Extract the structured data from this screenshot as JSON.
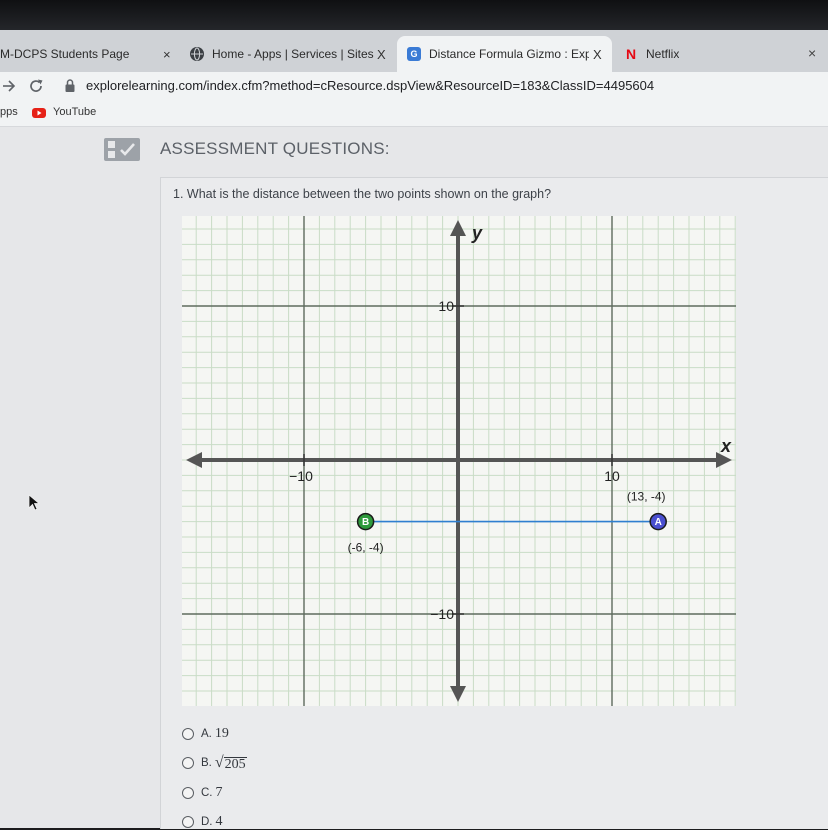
{
  "browser": {
    "tabs": [
      {
        "label": "M-DCPS Students Page",
        "close": "×",
        "icon": "none"
      },
      {
        "label": "Home - Apps | Services | Sites",
        "close": "X",
        "icon": "globe-icon"
      },
      {
        "label": "Distance Formula Gizmo : Expl",
        "close": "X",
        "icon": "gizmo-icon",
        "icon_text": "G",
        "active": true
      },
      {
        "label": "Netflix",
        "icon": "netflix-icon",
        "icon_text": "N"
      }
    ],
    "window_close": "×",
    "url": "explorelearning.com/index.cfm?method=cResource.dspView&ResourceID=183&ClassID=4495604",
    "bookmarks": [
      {
        "label": "pps"
      },
      {
        "label": "YouTube",
        "icon": "youtube-icon"
      }
    ]
  },
  "page": {
    "header_title": "ASSESSMENT QUESTIONS:",
    "question": "1. What is the distance between the two points shown on the graph?",
    "choices": [
      {
        "letter": "A.",
        "value": "19"
      },
      {
        "letter": "B.",
        "radical": "√",
        "value": "205"
      },
      {
        "letter": "C.",
        "value": "7"
      },
      {
        "letter": "D.",
        "value": "4"
      }
    ]
  },
  "graph": {
    "x_axis_label": "x",
    "y_axis_label": "y",
    "x_range": [
      -18,
      18
    ],
    "y_range": [
      -16,
      16
    ],
    "tick_labels": {
      "x_neg": "−10",
      "x_pos": "10",
      "y_pos": "10",
      "y_neg": "−10"
    },
    "line_color": "#2f7fd0",
    "points": [
      {
        "letter": "B",
        "x": -6,
        "y": -4,
        "label": "(-6, -4)",
        "color": "#2e9a3c"
      },
      {
        "letter": "A",
        "x": 13,
        "y": -4,
        "label": "(13, -4)",
        "color": "#4a4fd0"
      }
    ]
  }
}
